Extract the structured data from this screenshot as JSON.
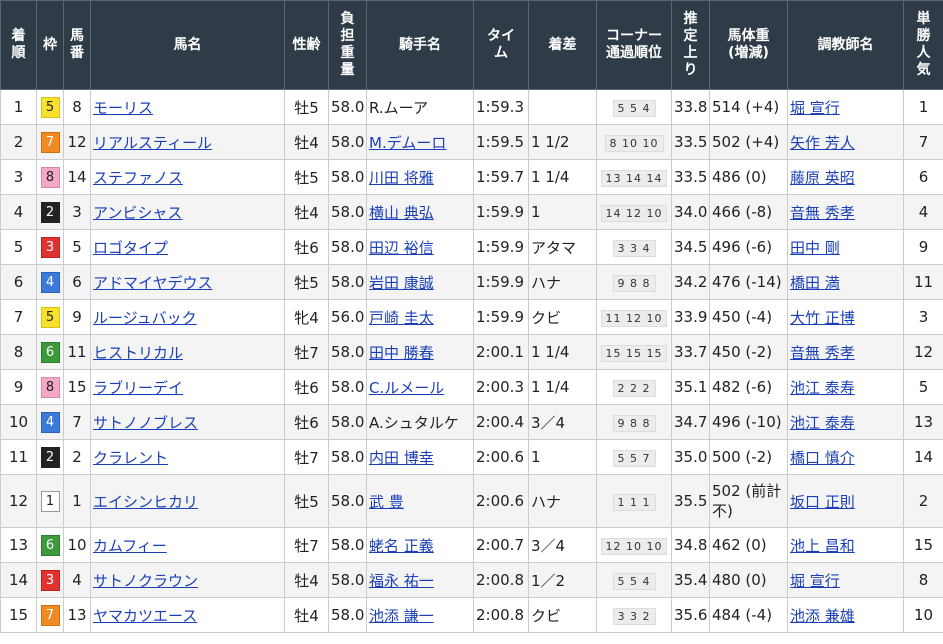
{
  "headers": {
    "rank": "着順",
    "waku": "枠",
    "umaban": "馬番",
    "horse": "馬名",
    "sexage": "性齢",
    "weight": "負担重量",
    "jockey": "騎手名",
    "time": "タイム",
    "margin": "着差",
    "corner": "コーナー通過順位",
    "last3f": "推定上り",
    "bodyweight": "馬体重(増減)",
    "trainer": "調教師名",
    "popularity": "単勝人気"
  },
  "rows": [
    {
      "rank": "1",
      "waku": "5",
      "umaban": "8",
      "horse": "モーリス",
      "sexage": "牡5",
      "weight": "58.0",
      "jockey": "R.ムーア",
      "jockey_link": false,
      "time": "1:59.3",
      "margin": "",
      "corner": "5 5 4",
      "last3f": "33.8",
      "bodyweight": "514 (+4)",
      "trainer": "堀 宣行",
      "pop": "1"
    },
    {
      "rank": "2",
      "waku": "7",
      "umaban": "12",
      "horse": "リアルスティール",
      "sexage": "牡4",
      "weight": "58.0",
      "jockey": "M.デムーロ",
      "jockey_link": true,
      "time": "1:59.5",
      "margin": "1 1/2",
      "corner": "8 10 10",
      "last3f": "33.5",
      "bodyweight": "502 (+4)",
      "trainer": "矢作 芳人",
      "pop": "7"
    },
    {
      "rank": "3",
      "waku": "8",
      "umaban": "14",
      "horse": "ステファノス",
      "sexage": "牡5",
      "weight": "58.0",
      "jockey": "川田 将雅",
      "jockey_link": true,
      "time": "1:59.7",
      "margin": "1 1/4",
      "corner": "13 14 14",
      "last3f": "33.5",
      "bodyweight": "486 (0)",
      "trainer": "藤原 英昭",
      "pop": "6"
    },
    {
      "rank": "4",
      "waku": "2",
      "umaban": "3",
      "horse": "アンビシャス",
      "sexage": "牡4",
      "weight": "58.0",
      "jockey": "横山 典弘",
      "jockey_link": true,
      "time": "1:59.9",
      "margin": "1",
      "corner": "14 12 10",
      "last3f": "34.0",
      "bodyweight": "466 (-8)",
      "trainer": "音無 秀孝",
      "pop": "4"
    },
    {
      "rank": "5",
      "waku": "3",
      "umaban": "5",
      "horse": "ロゴタイプ",
      "sexage": "牡6",
      "weight": "58.0",
      "jockey": "田辺 裕信",
      "jockey_link": true,
      "time": "1:59.9",
      "margin": "アタマ",
      "corner": "3 3 4",
      "last3f": "34.5",
      "bodyweight": "496 (-6)",
      "trainer": "田中 剛",
      "pop": "9"
    },
    {
      "rank": "6",
      "waku": "4",
      "umaban": "6",
      "horse": "アドマイヤデウス",
      "sexage": "牡5",
      "weight": "58.0",
      "jockey": "岩田 康誠",
      "jockey_link": true,
      "time": "1:59.9",
      "margin": "ハナ",
      "corner": "9 8 8",
      "last3f": "34.2",
      "bodyweight": "476 (-14)",
      "trainer": "橋田 満",
      "pop": "11"
    },
    {
      "rank": "7",
      "waku": "5",
      "umaban": "9",
      "horse": "ルージュバック",
      "sexage": "牝4",
      "weight": "56.0",
      "jockey": "戸崎 圭太",
      "jockey_link": true,
      "time": "1:59.9",
      "margin": "クビ",
      "corner": "11 12 10",
      "last3f": "33.9",
      "bodyweight": "450 (-4)",
      "trainer": "大竹 正博",
      "pop": "3"
    },
    {
      "rank": "8",
      "waku": "6",
      "umaban": "11",
      "horse": "ヒストリカル",
      "sexage": "牡7",
      "weight": "58.0",
      "jockey": "田中 勝春",
      "jockey_link": true,
      "time": "2:00.1",
      "margin": "1 1/4",
      "corner": "15 15 15",
      "last3f": "33.7",
      "bodyweight": "450 (-2)",
      "trainer": "音無 秀孝",
      "pop": "12"
    },
    {
      "rank": "9",
      "waku": "8",
      "umaban": "15",
      "horse": "ラブリーデイ",
      "sexage": "牡6",
      "weight": "58.0",
      "jockey": "C.ルメール",
      "jockey_link": true,
      "time": "2:00.3",
      "margin": "1 1/4",
      "corner": "2 2 2",
      "last3f": "35.1",
      "bodyweight": "482 (-6)",
      "trainer": "池江 泰寿",
      "pop": "5"
    },
    {
      "rank": "10",
      "waku": "4",
      "umaban": "7",
      "horse": "サトノノブレス",
      "sexage": "牡6",
      "weight": "58.0",
      "jockey": "A.シュタルケ",
      "jockey_link": false,
      "time": "2:00.4",
      "margin": "3／4",
      "corner": "9 8 8",
      "last3f": "34.7",
      "bodyweight": "496 (-10)",
      "trainer": "池江 泰寿",
      "pop": "13"
    },
    {
      "rank": "11",
      "waku": "2",
      "umaban": "2",
      "horse": "クラレント",
      "sexage": "牡7",
      "weight": "58.0",
      "jockey": "内田 博幸",
      "jockey_link": true,
      "time": "2:00.6",
      "margin": "1",
      "corner": "5 5 7",
      "last3f": "35.0",
      "bodyweight": "500 (-2)",
      "trainer": "橋口 慎介",
      "pop": "14"
    },
    {
      "rank": "12",
      "waku": "1",
      "umaban": "1",
      "horse": "エイシンヒカリ",
      "sexage": "牡5",
      "weight": "58.0",
      "jockey": "武 豊",
      "jockey_link": true,
      "time": "2:00.6",
      "margin": "ハナ",
      "corner": "1 1 1",
      "last3f": "35.5",
      "bodyweight": "502 (前計不)",
      "trainer": "坂口 正則",
      "pop": "2"
    },
    {
      "rank": "13",
      "waku": "6",
      "umaban": "10",
      "horse": "カムフィー",
      "sexage": "牡7",
      "weight": "58.0",
      "jockey": "蛯名 正義",
      "jockey_link": true,
      "time": "2:00.7",
      "margin": "3／4",
      "corner": "12 10 10",
      "last3f": "34.8",
      "bodyweight": "462 (0)",
      "trainer": "池上 昌和",
      "pop": "15"
    },
    {
      "rank": "14",
      "waku": "3",
      "umaban": "4",
      "horse": "サトノクラウン",
      "sexage": "牡4",
      "weight": "58.0",
      "jockey": "福永 祐一",
      "jockey_link": true,
      "time": "2:00.8",
      "margin": "1／2",
      "corner": "5 5 4",
      "last3f": "35.4",
      "bodyweight": "480 (0)",
      "trainer": "堀 宣行",
      "pop": "8"
    },
    {
      "rank": "15",
      "waku": "7",
      "umaban": "13",
      "horse": "ヤマカツエース",
      "sexage": "牡4",
      "weight": "58.0",
      "jockey": "池添 謙一",
      "jockey_link": true,
      "time": "2:00.8",
      "margin": "クビ",
      "corner": "3 3 2",
      "last3f": "35.6",
      "bodyweight": "484 (-4)",
      "trainer": "池添 兼雄",
      "pop": "10"
    }
  ]
}
